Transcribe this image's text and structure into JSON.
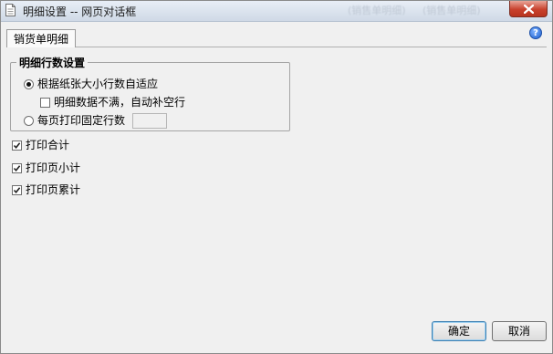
{
  "window": {
    "title": "明细设置 -- 网页对话框",
    "ghost_text": [
      "(销售单明细)",
      "(销售单明细)"
    ]
  },
  "tabs": [
    {
      "label": "销货单明细",
      "active": true
    }
  ],
  "group": {
    "title": "明细行数设置",
    "options": {
      "auto_fit": {
        "label": "根据纸张大小行数自适应",
        "checked": true
      },
      "fill_empty": {
        "label": "明细数据不满，自动补空行",
        "checked": false
      },
      "fixed_rows": {
        "label": "每页打印固定行数",
        "checked": false,
        "value": ""
      }
    }
  },
  "checkboxes": {
    "print_total": {
      "label": "打印合计",
      "checked": true
    },
    "print_page_subtotal": {
      "label": "打印页小计",
      "checked": true
    },
    "print_page_cumulative": {
      "label": "打印页累计",
      "checked": true
    }
  },
  "buttons": {
    "ok": "确定",
    "cancel": "取消"
  },
  "icons": {
    "title": "document-icon",
    "close": "close-icon",
    "help": "help-icon"
  },
  "colors": {
    "close_button": "#c8412d",
    "help_icon": "#1d5fcf",
    "dialog_bg": "#f0f0f0"
  }
}
